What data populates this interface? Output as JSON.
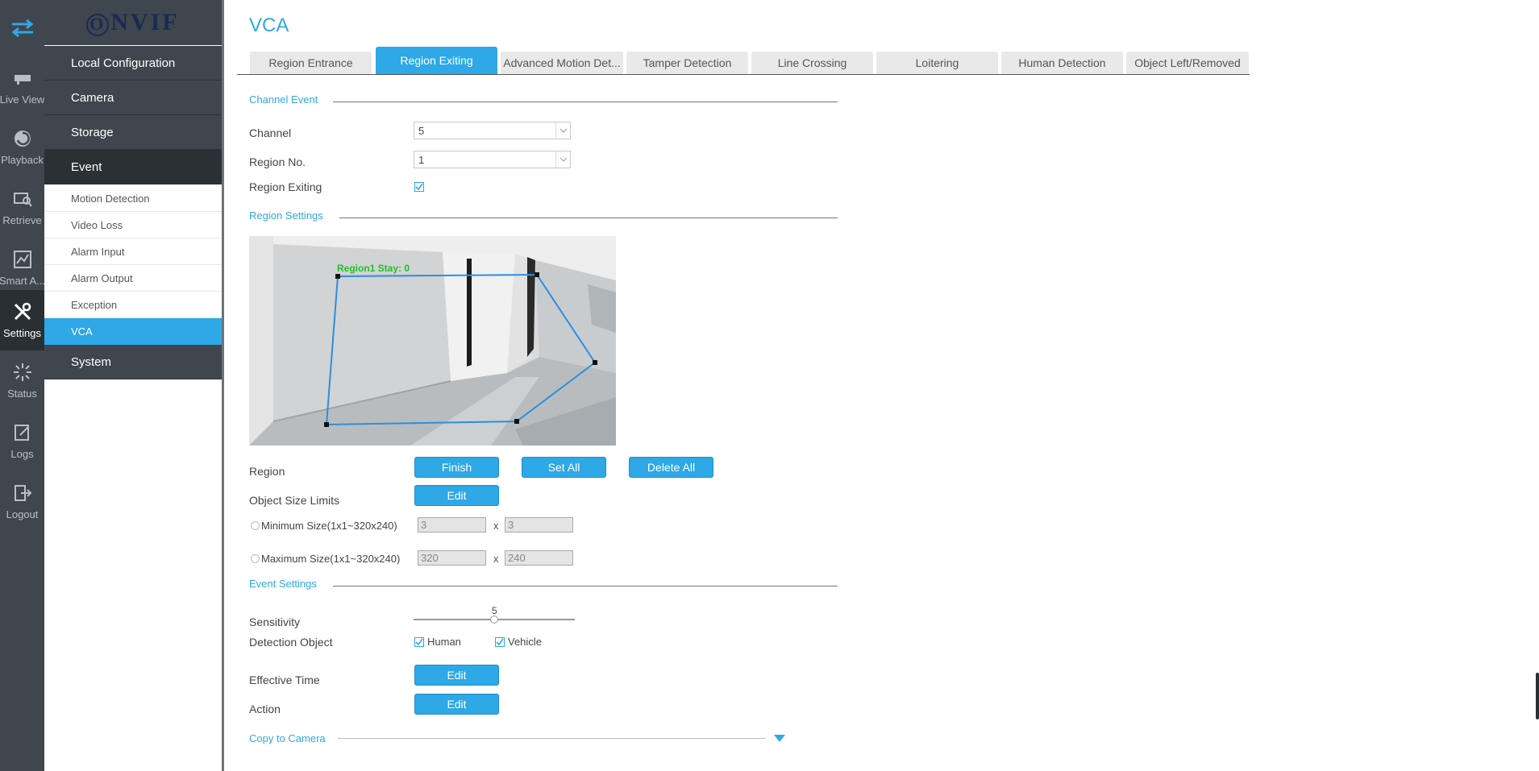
{
  "rail": {
    "items": [
      {
        "label": "Live View",
        "icon": "live-view-icon"
      },
      {
        "label": "Playback",
        "icon": "playback-icon"
      },
      {
        "label": "Retrieve",
        "icon": "retrieve-icon"
      },
      {
        "label": "Smart A...",
        "icon": "smart-analytics-icon"
      },
      {
        "label": "Settings",
        "icon": "settings-icon"
      },
      {
        "label": "Status",
        "icon": "status-icon"
      },
      {
        "label": "Logs",
        "icon": "logs-icon"
      },
      {
        "label": "Logout",
        "icon": "logout-icon"
      }
    ],
    "active": "Settings"
  },
  "logo": {
    "text": "NVIF",
    "first_letter": "O"
  },
  "menu": {
    "local_configuration": "Local Configuration",
    "camera": "Camera",
    "storage": "Storage",
    "event": "Event",
    "event_items": [
      "Motion Detection",
      "Video Loss",
      "Alarm Input",
      "Alarm Output",
      "Exception",
      "VCA"
    ],
    "system": "System"
  },
  "page": {
    "title": "VCA",
    "tabs": [
      "Region Entrance",
      "Region Exiting",
      "Advanced Motion Det...",
      "Tamper Detection",
      "Line Crossing",
      "Loitering",
      "Human Detection",
      "Object Left/Removed"
    ],
    "active_tab": "Region Exiting"
  },
  "channel_event": {
    "title": "Channel Event",
    "channel_label": "Channel",
    "channel_value": "5",
    "region_no_label": "Region No.",
    "region_no_value": "1",
    "region_exiting_label": "Region Exiting",
    "region_exiting_checked": true
  },
  "region_settings": {
    "title": "Region Settings",
    "overlay_text": "Region1 Stay: 0",
    "region_label": "Region",
    "finish_label": "Finish",
    "set_all_label": "Set All",
    "delete_all_label": "Delete All",
    "object_size_label": "Object Size Limits",
    "edit_label": "Edit",
    "min_size_label": "Minimum Size(1x1~320x240)",
    "min_w": "3",
    "min_h": "3",
    "max_size_label": "Maximum Size(1x1~320x240)",
    "max_w": "320",
    "max_h": "240",
    "x_sep": "x"
  },
  "event_settings": {
    "title": "Event Settings",
    "sensitivity_label": "Sensitivity",
    "sensitivity_value": "5",
    "sensitivity_fraction": 0.5,
    "detection_object_label": "Detection Object",
    "human_label": "Human",
    "vehicle_label": "Vehicle",
    "effective_time_label": "Effective Time",
    "effective_time_btn": "Edit",
    "action_label": "Action",
    "action_btn": "Edit"
  },
  "copy_to_camera": {
    "title": "Copy to Camera"
  },
  "colors": {
    "accent": "#2ea8e6",
    "rail_bg": "#3f464d",
    "region_line": "#2a8fe0",
    "overlay_text": "#22c02a"
  }
}
